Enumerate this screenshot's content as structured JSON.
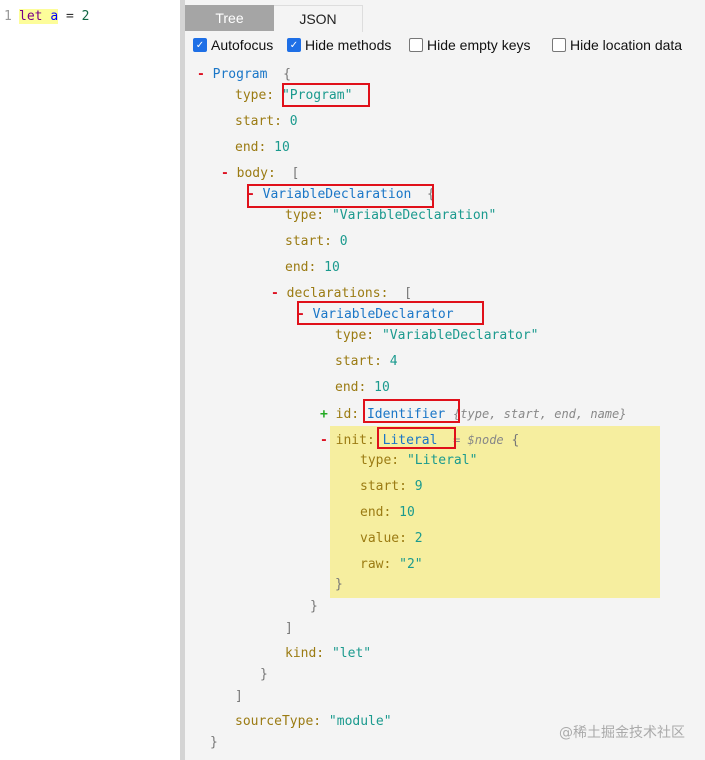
{
  "editor": {
    "line_number": "1",
    "code": {
      "kw": "let",
      "var": "a",
      "op": "=",
      "num": "2"
    }
  },
  "tabs": [
    {
      "label": "Tree"
    },
    {
      "label": "JSON"
    }
  ],
  "options": [
    {
      "label": "Autofocus",
      "checked": true
    },
    {
      "label": "Hide methods",
      "checked": true
    },
    {
      "label": "Hide empty keys",
      "checked": false
    },
    {
      "label": "Hide location data",
      "checked": false
    }
  ],
  "tree": {
    "program": {
      "label": "Program",
      "open": "{",
      "close": "}"
    },
    "program_fields": {
      "type_key": "type:",
      "type_val": "\"Program\"",
      "start_key": "start:",
      "start_val": "0",
      "end_key": "end:",
      "end_val": "10",
      "body_key": "body:",
      "body_open": "[",
      "body_close": "]",
      "sourcetype_key": "sourceType:",
      "sourcetype_val": "\"module\""
    },
    "vardecl": {
      "label": "VariableDeclaration",
      "open": "{",
      "close": "}",
      "type_key": "type:",
      "type_val": "\"VariableDeclaration\"",
      "start_key": "start:",
      "start_val": "0",
      "end_key": "end:",
      "end_val": "10",
      "decls_key": "declarations:",
      "decls_open": "[",
      "decls_close": "]",
      "kind_key": "kind:",
      "kind_val": "\"let\""
    },
    "declarator": {
      "label": "VariableDeclarator",
      "close": "}",
      "type_key": "type:",
      "type_val": "\"VariableDeclarator\"",
      "start_key": "start:",
      "start_val": "4",
      "end_key": "end:",
      "end_val": "10",
      "id_key": "id:",
      "id_label": "Identifier",
      "id_summary": "{type, start, end, name}"
    },
    "init": {
      "key": "init:",
      "label": "Literal",
      "meta": "= $node",
      "open": "{",
      "close": "}",
      "type_key": "type:",
      "type_val": "\"Literal\"",
      "start_key": "start:",
      "start_val": "9",
      "end_key": "end:",
      "end_val": "10",
      "value_key": "value:",
      "value_val": "2",
      "raw_key": "raw:",
      "raw_val": "\"2\""
    },
    "toggle_minus": "-",
    "toggle_plus": "+"
  },
  "watermark": "@稀土掘金技术社区",
  "colors": {
    "highlight_box": "#e0101a",
    "init_highlight": "#f6ee9f",
    "tab_active": "#a5a5a5"
  }
}
